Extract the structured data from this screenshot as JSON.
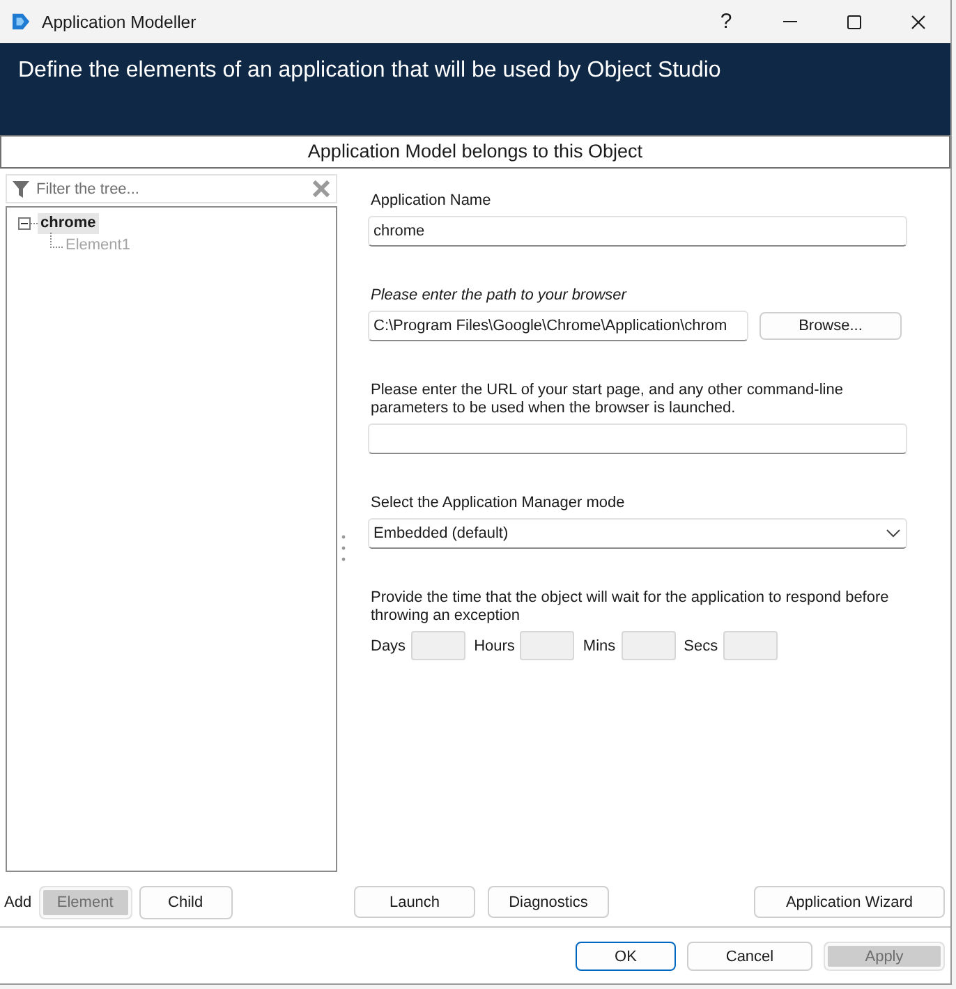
{
  "window": {
    "title": "Application Modeller",
    "help": "?"
  },
  "banner": {
    "text": "Define the elements of an application that will be used by Object Studio"
  },
  "model_owner": {
    "text": "Application Model belongs to this Object"
  },
  "tree_filter": {
    "placeholder": "Filter the tree..."
  },
  "tree": [
    {
      "label": "chrome",
      "selected": true,
      "expanded": true,
      "disabled": false,
      "children": [
        {
          "label": "Element1",
          "selected": false,
          "disabled": true
        }
      ]
    }
  ],
  "add_bar": {
    "label": "Add",
    "buttons": [
      {
        "label": "Element",
        "disabled": true
      },
      {
        "label": "Child",
        "disabled": false
      }
    ]
  },
  "form": [
    {
      "kind": "text",
      "label": "Application Name",
      "value": "chrome"
    },
    {
      "kind": "path",
      "label": "Please enter the path to your browser",
      "value": "C:\\Program Files\\Google\\Chrome\\Application\\chrom",
      "button": "Browse..."
    },
    {
      "kind": "text",
      "label": "Please enter the URL of your start page, and any other command-line parameters to be used when the browser is launched."
    },
    {
      "kind": "select",
      "label": "Select the Application Manager mode",
      "value": "Embedded (default)"
    },
    {
      "kind": "timeout",
      "label": "Provide the time that the object will wait for the application to respond before throwing an exception",
      "units": [
        "Days",
        "Hours",
        "Mins",
        "Secs"
      ]
    }
  ],
  "action_buttons": [
    {
      "label": "Launch"
    },
    {
      "label": "Diagnostics"
    }
  ],
  "wizard_button": {
    "label": "Application Wizard"
  },
  "footer_buttons": [
    {
      "label": "OK",
      "default": true,
      "disabled": false
    },
    {
      "label": "Cancel",
      "default": false,
      "disabled": false
    },
    {
      "label": "Apply",
      "default": false,
      "disabled": true
    }
  ]
}
